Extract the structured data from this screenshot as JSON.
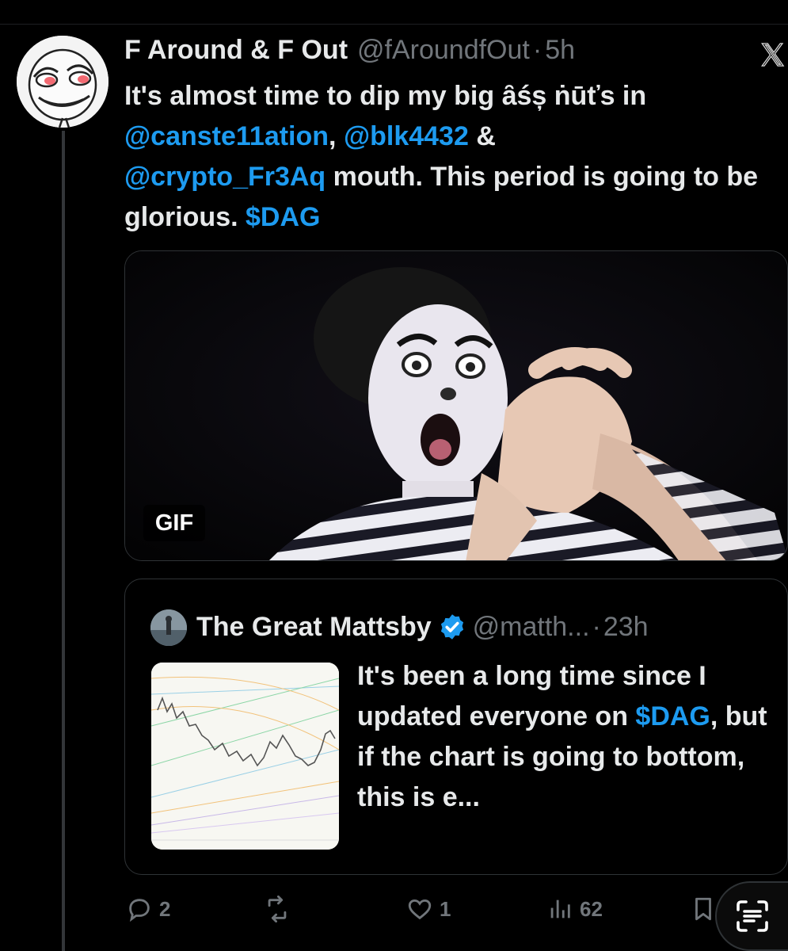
{
  "tweet": {
    "display_name": "F Around & F Out",
    "handle": "@fAroundfOut",
    "separator": "·",
    "time": "5h",
    "text": {
      "part1": "It's almost time to dip my big ȃśș ṅūťs in ",
      "mention1": "@canste11ation",
      "part2": ", ",
      "mention2": "@blk4432",
      "part3": " & ",
      "mention3": "@crypto_Fr3Aq",
      "part4": " mouth. This period is going to be glorious.  ",
      "cashtag": "$DAG"
    },
    "media": {
      "badge": "GIF"
    }
  },
  "quote": {
    "display_name": "The Great Mattsby",
    "handle": "@matth...",
    "separator": "·",
    "time": "23h",
    "text_part1": "It's been a long time since I updated everyone on ",
    "cashtag": "$DAG",
    "text_part2": ", but if the chart is going to bottom, this is e..."
  },
  "actions": {
    "replies": "2",
    "reposts": "",
    "likes": "1",
    "views": "62"
  },
  "colors": {
    "background": "#000000",
    "text": "#e7e9ea",
    "muted": "#71767b",
    "link": "#1d9bf0",
    "border": "#2f3336"
  },
  "icons": [
    "x-logo-icon",
    "verified-badge-icon",
    "reply-icon",
    "repost-icon",
    "like-icon",
    "views-icon",
    "bookmark-icon",
    "scan-text-icon"
  ]
}
